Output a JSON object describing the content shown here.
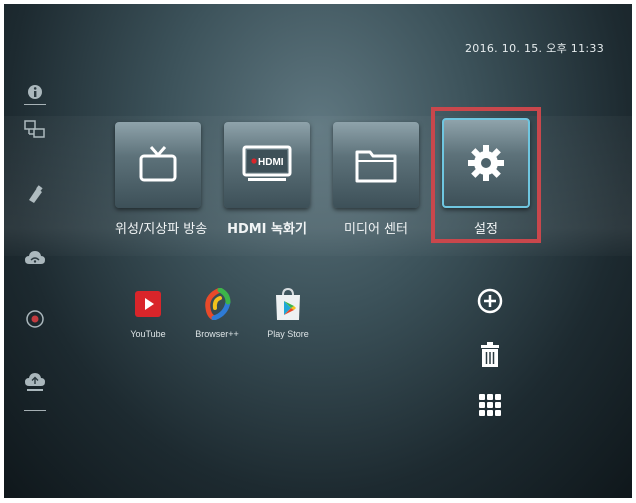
{
  "status": {
    "datetime": "2016. 10. 15. 오후 11:33"
  },
  "sidebar": {
    "items": [
      {
        "icon": "info-icon"
      },
      {
        "icon": "network-icon"
      },
      {
        "icon": "usb-icon"
      },
      {
        "icon": "wifi-cloud-icon"
      },
      {
        "icon": "record-icon"
      },
      {
        "icon": "cloud-upload-icon"
      }
    ]
  },
  "tiles": [
    {
      "label": "위성/지상파 방송",
      "icon": "tv-icon"
    },
    {
      "label": "HDMI 녹화기",
      "icon": "hdmi-icon",
      "icon_text": "HDMI"
    },
    {
      "label": "미디어 센터",
      "icon": "folder-icon"
    },
    {
      "label": "설정",
      "icon": "gear-icon",
      "selected": true
    }
  ],
  "apps": [
    {
      "label": "YouTube",
      "icon": "youtube-icon"
    },
    {
      "label": "Browser++",
      "icon": "browser-icon"
    },
    {
      "label": "Play Store",
      "icon": "play-store-icon"
    }
  ],
  "tools": [
    {
      "icon": "add-icon"
    },
    {
      "icon": "trash-icon"
    },
    {
      "icon": "grid-icon"
    }
  ],
  "colors": {
    "selection": "#c9474c",
    "focus": "#6fc6e0",
    "youtube": "#d9252a"
  }
}
